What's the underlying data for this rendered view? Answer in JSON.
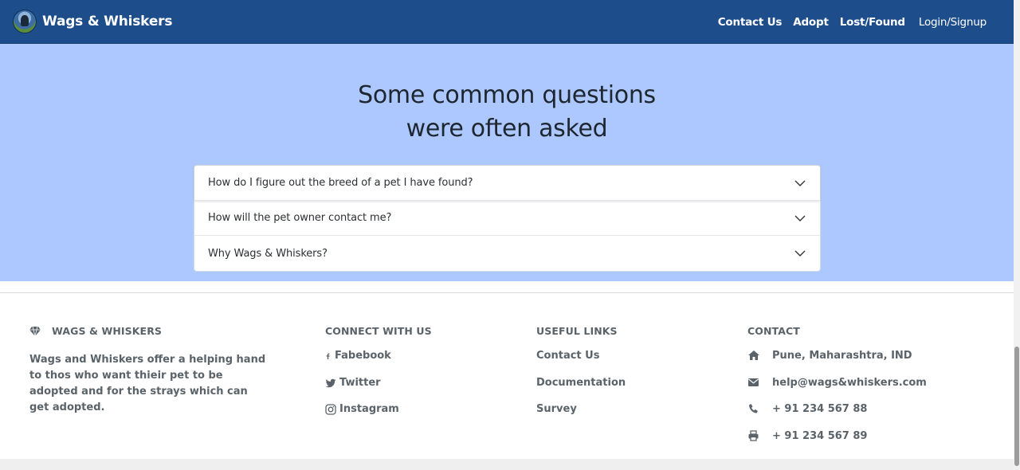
{
  "nav": {
    "brand": "Wags & Whiskers",
    "links": [
      "Contact Us",
      "Adopt",
      "Lost/Found"
    ],
    "login": "Login/Signup"
  },
  "faq": {
    "title_line1": "Some common questions",
    "title_line2": "were often asked",
    "questions": [
      "How do I figure out the breed of a pet I have found?",
      "How will the pet owner contact me?",
      "Why Wags & Whiskers?"
    ]
  },
  "footer": {
    "brand_heading": "WAGS & WHISKERS",
    "about": "Wags and Whiskers offer a helping hand to thos who want thieir pet to be adopted and for the strays which can get adopted.",
    "connect_heading": "CONNECT WITH US",
    "social": [
      {
        "icon": "facebook-icon",
        "label": "Fabebook"
      },
      {
        "icon": "twitter-icon",
        "label": "Twitter"
      },
      {
        "icon": "instagram-icon",
        "label": "Instagram"
      }
    ],
    "useful_heading": "USEFUL LINKS",
    "useful": [
      "Contact Us",
      "Documentation",
      "Survey"
    ],
    "contact_heading": "CONTACT",
    "contact": [
      {
        "icon": "home-icon",
        "text": "Pune, Maharashtra, IND"
      },
      {
        "icon": "envelope-icon",
        "text": "help@wags&whiskers.com"
      },
      {
        "icon": "phone-icon",
        "text": "+ 91 234 567 88"
      },
      {
        "icon": "printer-icon",
        "text": "+ 91 234 567 89"
      }
    ]
  },
  "colors": {
    "navbar": "#1e4d8c",
    "faq_bg": "#adc8ff",
    "footer_text": "#5b636a"
  }
}
